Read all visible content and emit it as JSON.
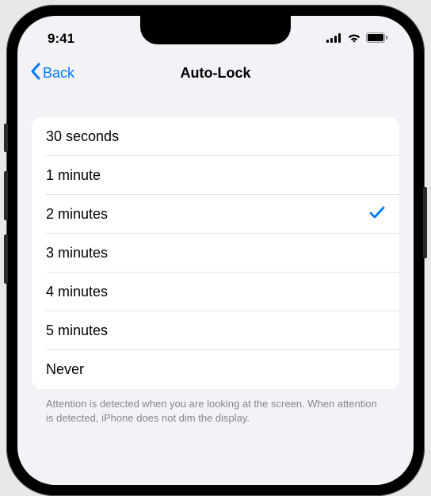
{
  "status": {
    "time": "9:41"
  },
  "nav": {
    "back_label": "Back",
    "title": "Auto-Lock"
  },
  "options": [
    {
      "label": "30 seconds",
      "selected": false
    },
    {
      "label": "1 minute",
      "selected": false
    },
    {
      "label": "2 minutes",
      "selected": true
    },
    {
      "label": "3 minutes",
      "selected": false
    },
    {
      "label": "4 minutes",
      "selected": false
    },
    {
      "label": "5 minutes",
      "selected": false
    },
    {
      "label": "Never",
      "selected": false
    }
  ],
  "footer_text": "Attention is detected when you are looking at the screen. When attention is detected, iPhone does not dim the display."
}
